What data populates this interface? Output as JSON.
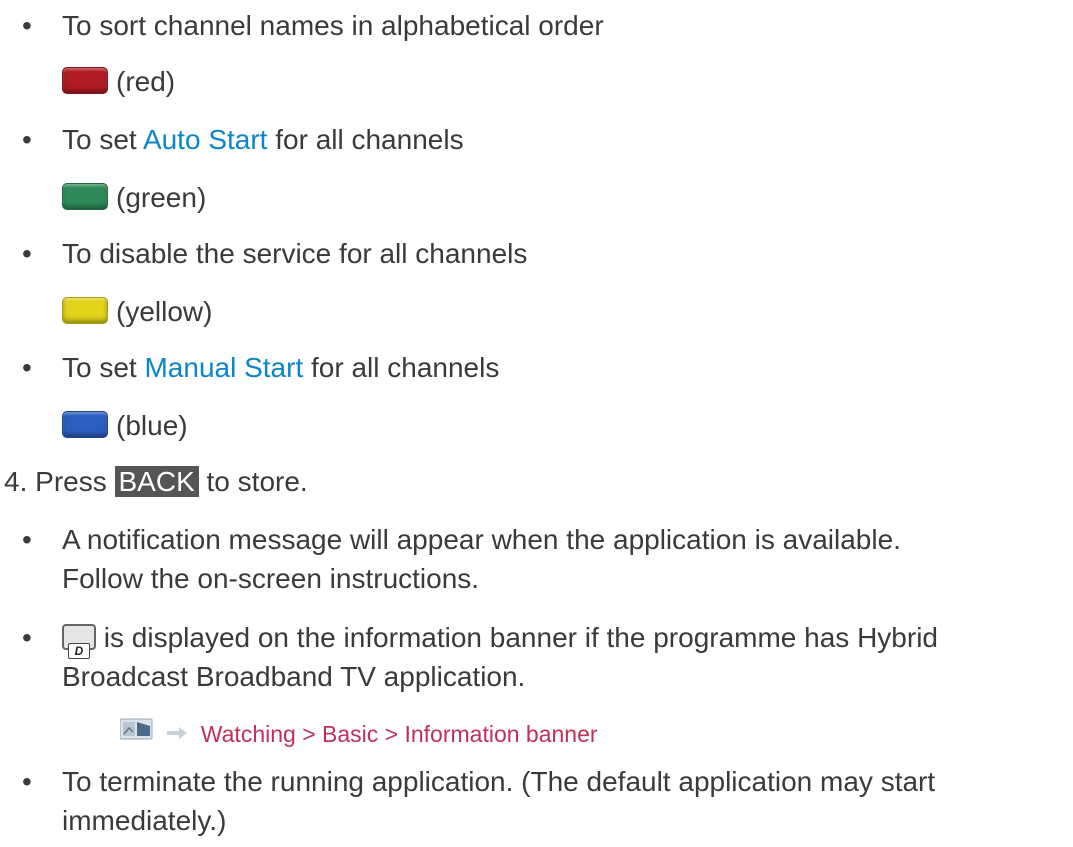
{
  "items": {
    "sort": {
      "bullet": "•",
      "text": "To sort channel names in alphabetical order"
    },
    "red": {
      "color": "#b01c22",
      "label": "(red)"
    },
    "auto": {
      "bullet": "•",
      "pre": "To set ",
      "link": "Auto Start",
      "post": " for all channels"
    },
    "green": {
      "color": "#2f8a5a",
      "label": "(green)"
    },
    "disable": {
      "bullet": "•",
      "text": "To disable the service for all channels"
    },
    "yellow": {
      "color": "#e2d21a",
      "label": "(yellow)"
    },
    "manual": {
      "bullet": "•",
      "pre": "To set ",
      "link": "Manual Start",
      "post": " for all channels"
    },
    "blue": {
      "color": "#2a5fc0",
      "label": "(blue)"
    }
  },
  "step4": {
    "number": "4.",
    "pre": "Press ",
    "button": "BACK",
    "post": " to store."
  },
  "notes": {
    "n1_line1": "A notification message will appear when the application is available.",
    "n1_line2": "Follow the on-screen instructions.",
    "n2_line1_post": " is displayed on the information banner if the programme has Hybrid",
    "n2_line2": "Broadcast Broadband TV application.",
    "d_icon_letter": "D",
    "reference": "Watching > Basic > Information banner",
    "n3_line1": "To terminate the running application. (The default application may start",
    "n3_line2": "immediately.)",
    "bullet": "•"
  },
  "colors": {
    "text": "#3a3a3a",
    "link": "#0b86c6",
    "reference": "#c0305a",
    "back_button": "#555555"
  }
}
